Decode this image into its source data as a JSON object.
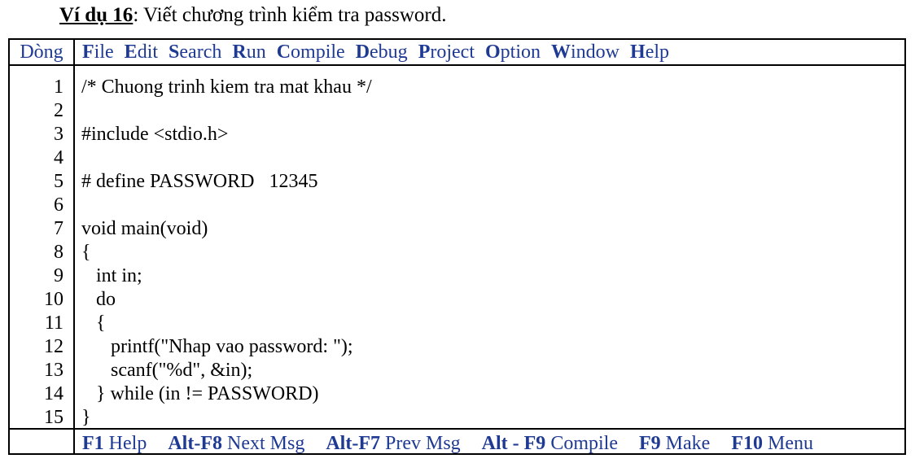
{
  "heading": {
    "lead": "Ví dụ 16",
    "rest": ": Viết chương trình kiểm tra password."
  },
  "menu": {
    "line_label": "Dòng",
    "items": [
      {
        "hotkey": "F",
        "rest": "ile"
      },
      {
        "hotkey": "E",
        "rest": "dit"
      },
      {
        "hotkey": "S",
        "rest": "earch"
      },
      {
        "hotkey": "R",
        "rest": "un"
      },
      {
        "hotkey": "C",
        "rest": "ompile"
      },
      {
        "hotkey": "D",
        "rest": "ebug"
      },
      {
        "hotkey": "P",
        "rest": "roject"
      },
      {
        "hotkey": "O",
        "rest": "ption"
      },
      {
        "hotkey": "W",
        "rest": "indow"
      },
      {
        "hotkey": "H",
        "rest": "elp"
      }
    ]
  },
  "editor": {
    "line_numbers": [
      "1",
      "2",
      "3",
      "4",
      "5",
      "6",
      "7",
      "8",
      "9",
      "10",
      "11",
      "12",
      "13",
      "14",
      "15"
    ],
    "lines": [
      "/* Chuong trinh kiem tra mat khau */",
      "",
      "#include <stdio.h>",
      "",
      "# define PASSWORD   12345",
      "",
      "void main(void)",
      "{",
      "   int in;",
      "   do",
      "   {",
      "      printf(\"Nhap vao password: \");",
      "      scanf(\"%d\", &in);",
      "   } while (in != PASSWORD)",
      "}"
    ]
  },
  "status_bar": {
    "items": [
      {
        "key": "F1",
        "label": " Help"
      },
      {
        "key": "Alt-F8",
        "label": " Next Msg"
      },
      {
        "key": "Alt-F7",
        "label": " Prev Msg"
      },
      {
        "key": "Alt - F9",
        "label": " Compile"
      },
      {
        "key": "F9",
        "label": " Make"
      },
      {
        "key": "F10",
        "label": " Menu"
      }
    ]
  },
  "colors": {
    "menu_text": "#1f3a93",
    "border": "#000000"
  }
}
